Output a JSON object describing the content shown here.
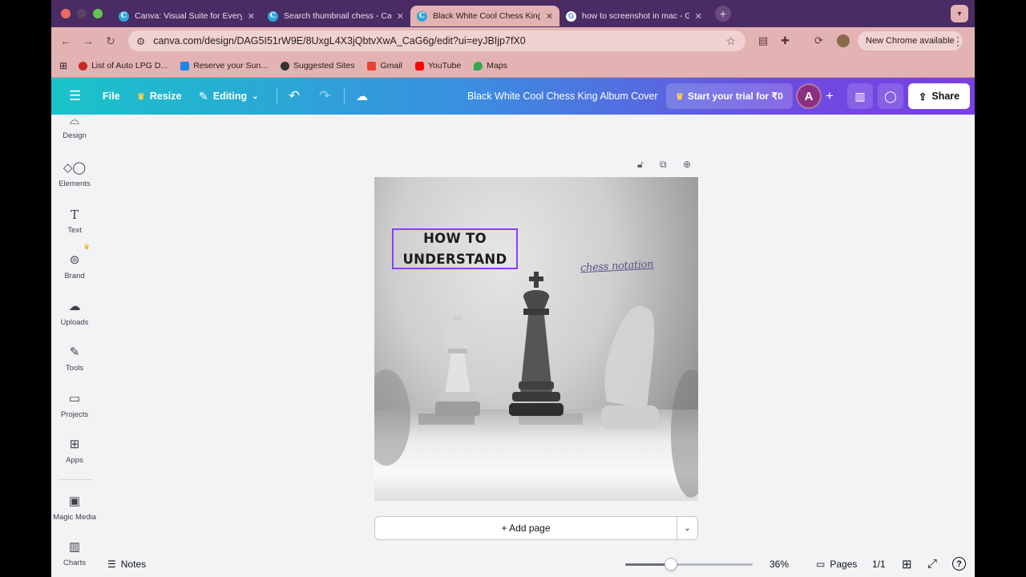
{
  "browser": {
    "tabs": [
      {
        "label": "Canva: Visual Suite for Every",
        "icon": "canva-favicon",
        "active": false
      },
      {
        "label": "Search thumbnail chess - Ca",
        "icon": "canva-favicon",
        "active": false
      },
      {
        "label": "Black White Cool Chess King",
        "icon": "canva-favicon",
        "active": true
      },
      {
        "label": "how to screenshot in mac - G",
        "icon": "google-favicon",
        "active": false
      }
    ],
    "url": "canva.com/design/DAG5I51rW9E/8UxgL4X3jQbtvXwA_CaG6g/edit?ui=eyJBIjp7fX0",
    "new_chrome": "New Chrome available",
    "bookmarks": [
      {
        "label": "List of Auto LPG D...",
        "color": "#c62828"
      },
      {
        "label": "Reserve your Sun...",
        "color": "#1e88e5"
      },
      {
        "label": "Suggested Sites",
        "color": "#333333"
      },
      {
        "label": "Gmail",
        "color": "#ea4335"
      },
      {
        "label": "YouTube",
        "color": "#ff0000"
      },
      {
        "label": "Maps",
        "color": "#34a853"
      }
    ]
  },
  "topbar": {
    "file": "File",
    "resize": "Resize",
    "editing": "Editing",
    "doc_title": "Black White Cool Chess King Album Cover",
    "trial": "Start your trial for ₹0",
    "avatar": "A",
    "share": "Share"
  },
  "sidebar": {
    "items": [
      {
        "label": "Design",
        "icon": "design-icon"
      },
      {
        "label": "Elements",
        "icon": "elements-icon"
      },
      {
        "label": "Text",
        "icon": "text-icon"
      },
      {
        "label": "Brand",
        "icon": "brand-icon"
      },
      {
        "label": "Uploads",
        "icon": "uploads-icon"
      },
      {
        "label": "Tools",
        "icon": "tools-icon"
      },
      {
        "label": "Projects",
        "icon": "projects-icon"
      },
      {
        "label": "Apps",
        "icon": "apps-icon"
      },
      {
        "label": "Magic Media",
        "icon": "magic-media-icon"
      },
      {
        "label": "Charts",
        "icon": "charts-icon"
      }
    ]
  },
  "design": {
    "heading_line1": "HOW TO",
    "heading_line2": "UNDERSTAND",
    "script_text": "chess notation"
  },
  "canvas": {
    "add_page": "+ Add page"
  },
  "footer": {
    "notes": "Notes",
    "zoom": "36%",
    "zoom_level": 0.36,
    "pages": "Pages",
    "page_count": "1/1"
  },
  "colors": {
    "selection": "#8b3dff",
    "tab_bar": "#4b2b63",
    "chrome_bar": "#e3b3b3"
  }
}
